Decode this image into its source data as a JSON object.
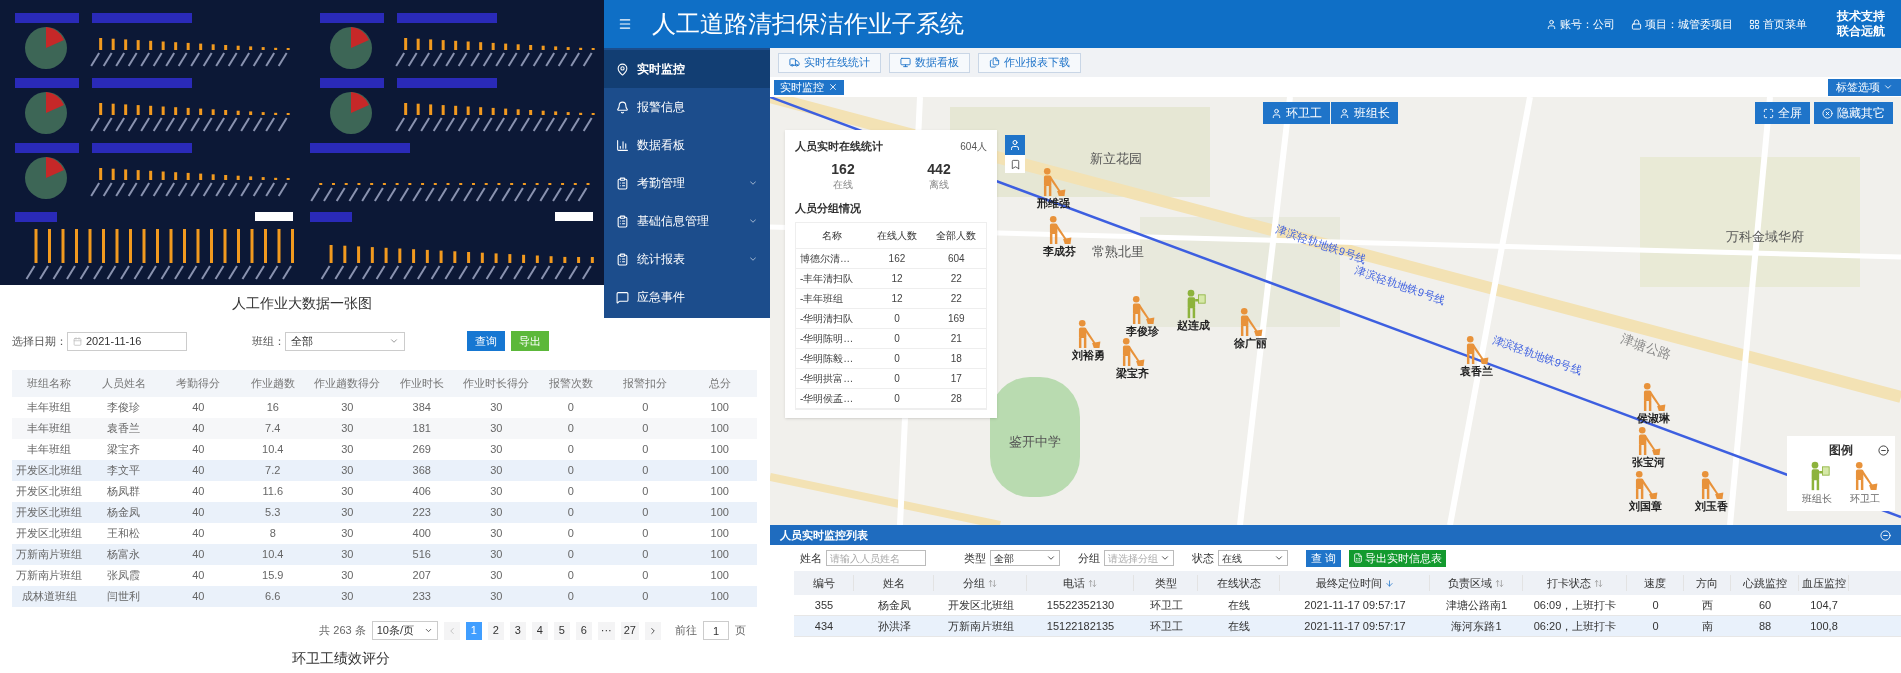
{
  "dashboard": {
    "caption": "人工作业大数据一张图"
  },
  "score_page": {
    "caption": "环卫工绩效评分",
    "filters": [
      {
        "label": "选择日期：",
        "value": "2021-11-16",
        "kind": "date"
      },
      {
        "label": "班组：",
        "value": "全部",
        "kind": "select"
      }
    ],
    "buttons": [
      {
        "label": "查询",
        "kind": "primary"
      },
      {
        "label": "导出",
        "kind": "success"
      }
    ],
    "columns": [
      "班组名称",
      "人员姓名",
      "考勤得分",
      "作业趟数",
      "作业趟数得分",
      "作业时长",
      "作业时长得分",
      "报警次数",
      "报警扣分",
      "总分"
    ],
    "rows": [
      [
        "丰年班组",
        "李俊珍",
        "40",
        "16",
        "30",
        "384",
        "30",
        "0",
        "0",
        "100"
      ],
      [
        "丰年班组",
        "袁香兰",
        "40",
        "7.4",
        "30",
        "181",
        "30",
        "0",
        "0",
        "100"
      ],
      [
        "丰年班组",
        "梁宝齐",
        "40",
        "10.4",
        "30",
        "269",
        "30",
        "0",
        "0",
        "100"
      ],
      [
        "开发区北班组",
        "李文平",
        "40",
        "7.2",
        "30",
        "368",
        "30",
        "0",
        "0",
        "100"
      ],
      [
        "开发区北班组",
        "杨凤群",
        "40",
        "11.6",
        "30",
        "406",
        "30",
        "0",
        "0",
        "100"
      ],
      [
        "开发区北班组",
        "杨金凤",
        "40",
        "5.3",
        "30",
        "223",
        "30",
        "0",
        "0",
        "100"
      ],
      [
        "开发区北班组",
        "王和松",
        "40",
        "8",
        "30",
        "400",
        "30",
        "0",
        "0",
        "100"
      ],
      [
        "万新南片班组",
        "杨富永",
        "40",
        "10.4",
        "30",
        "516",
        "30",
        "0",
        "0",
        "100"
      ],
      [
        "万新南片班组",
        "张凤霞",
        "40",
        "15.9",
        "30",
        "207",
        "30",
        "0",
        "0",
        "100"
      ],
      [
        "成林道班组",
        "闫世利",
        "40",
        "6.6",
        "30",
        "233",
        "30",
        "0",
        "0",
        "100"
      ]
    ],
    "pagination": {
      "total": "共 263 条",
      "page_size": "10条/页",
      "pages": [
        {
          "label": "1",
          "selected": true
        },
        {
          "label": "2",
          "selected": false
        },
        {
          "label": "3",
          "selected": false
        },
        {
          "label": "4",
          "selected": false
        },
        {
          "label": "5",
          "selected": false
        },
        {
          "label": "6",
          "selected": false
        },
        {
          "label": "···",
          "selected": false
        },
        {
          "label": "27",
          "selected": false
        }
      ],
      "goto_label": "前往",
      "goto_value": "1",
      "goto_suffix": "页"
    }
  },
  "app": {
    "title": "人工道路清扫保洁作业子系统",
    "header_links": [
      {
        "label": "账号：公司",
        "kind": "user"
      },
      {
        "label": "项目：城管委项目",
        "kind": "lock"
      },
      {
        "label": "首页菜单",
        "kind": "grid"
      }
    ],
    "support": [
      "技术支持",
      "联合远航"
    ],
    "sidebar": [
      {
        "label": "实时监控",
        "kind": "pin",
        "selected": true,
        "expandable": false
      },
      {
        "label": "报警信息",
        "kind": "alarm",
        "selected": false,
        "expandable": false
      },
      {
        "label": "数据看板",
        "kind": "chart",
        "selected": false,
        "expandable": false
      },
      {
        "label": "考勤管理",
        "kind": "list",
        "selected": false,
        "expandable": true
      },
      {
        "label": "基础信息管理",
        "kind": "list",
        "selected": false,
        "expandable": true
      },
      {
        "label": "统计报表",
        "kind": "list",
        "selected": false,
        "expandable": true
      },
      {
        "label": "应急事件",
        "kind": "message",
        "selected": false,
        "expandable": false
      }
    ],
    "toolbar": [
      {
        "label": "实时在线统计",
        "kind": "truck"
      },
      {
        "label": "数据看板",
        "kind": "monitor"
      },
      {
        "label": "作业报表下载",
        "kind": "files"
      }
    ],
    "open_tabs": [
      {
        "label": "实时监控",
        "selected": true
      }
    ],
    "tab_options": "标签选项",
    "map": {
      "place_labels": [
        "新立花园",
        "常熟北里",
        "万科金域华府",
        "鉴开中学"
      ],
      "road_label": "津塘公路",
      "rail_labels": [
        "津滨轻轨地铁9号线",
        "津滨轻轨地铁9号线",
        "津滨轻轨地铁9号线"
      ],
      "workers": [
        {
          "name": "邢维强",
          "kind": "cleaner"
        },
        {
          "name": "李成芬",
          "kind": "cleaner"
        },
        {
          "name": "李俊珍",
          "kind": "cleaner"
        },
        {
          "name": "赵连成",
          "kind": "leader"
        },
        {
          "name": "徐广丽",
          "kind": "cleaner"
        },
        {
          "name": "刘裕勇",
          "kind": "cleaner"
        },
        {
          "name": "梁宝齐",
          "kind": "cleaner"
        },
        {
          "name": "袁香兰",
          "kind": "cleaner"
        },
        {
          "name": "侯淑琳",
          "kind": "cleaner"
        },
        {
          "name": "张宝河",
          "kind": "cleaner"
        },
        {
          "name": "刘国章",
          "kind": "cleaner"
        },
        {
          "name": "刘玉香",
          "kind": "cleaner"
        }
      ],
      "stats": {
        "title": "人员实时在线统计",
        "total": "604人",
        "counts": [
          {
            "value": "162",
            "label": "在线"
          },
          {
            "value": "442",
            "label": "离线"
          }
        ],
        "group_title": "人员分组情况",
        "columns": [
          "名称",
          "在线人数",
          "全部人数"
        ],
        "rows": [
          [
            "博德尔清…",
            "162",
            "604"
          ],
          [
            "-丰年清扫队",
            "12",
            "22"
          ],
          [
            "-丰年班组",
            "12",
            "22"
          ],
          [
            "-华明清扫队",
            "0",
            "169"
          ],
          [
            "-华明陈明…",
            "0",
            "21"
          ],
          [
            "-华明陈毅…",
            "0",
            "18"
          ],
          [
            "-华明拱富…",
            "0",
            "17"
          ],
          [
            "-华明侯孟…",
            "0",
            "28"
          ]
        ]
      },
      "layer_buttons": [
        "环卫工",
        "班组长"
      ],
      "actions": [
        {
          "label": "全屏",
          "kind": "fullscreen"
        },
        {
          "label": "隐藏其它",
          "kind": "hide"
        }
      ],
      "legend": {
        "title": "图例",
        "items": [
          {
            "label": "班组长",
            "kind": "leader"
          },
          {
            "label": "环卫工",
            "kind": "cleaner"
          }
        ]
      }
    },
    "monitor_list": {
      "title": "人员实时监控列表",
      "filters": [
        {
          "label": "姓名",
          "kind": "text",
          "placeholder": "请输入人员姓名"
        },
        {
          "label": "类型",
          "kind": "select",
          "value": "全部"
        },
        {
          "label": "分组",
          "kind": "select",
          "placeholder": "请选择分组"
        },
        {
          "label": "状态",
          "kind": "select",
          "value": "在线"
        }
      ],
      "search_button": "查 询",
      "export_button": "导出实时信息表",
      "columns": [
        {
          "label": "编号",
          "sortable": false,
          "sorted": false
        },
        {
          "label": "姓名",
          "sortable": false,
          "sorted": false
        },
        {
          "label": "分组",
          "sortable": true,
          "sorted": false
        },
        {
          "label": "电话",
          "sortable": true,
          "sorted": false
        },
        {
          "label": "类型",
          "sortable": false,
          "sorted": false
        },
        {
          "label": "在线状态",
          "sortable": false,
          "sorted": false
        },
        {
          "label": "最终定位时间",
          "sortable": true,
          "sorted": true
        },
        {
          "label": "负责区域",
          "sortable": true,
          "sorted": false
        },
        {
          "label": "打卡状态",
          "sortable": true,
          "sorted": false
        },
        {
          "label": "速度",
          "sortable": false,
          "sorted": false
        },
        {
          "label": "方向",
          "sortable": false,
          "sorted": false
        },
        {
          "label": "心跳监控",
          "sortable": false,
          "sorted": false
        },
        {
          "label": "血压监控",
          "sortable": false,
          "sorted": false
        }
      ],
      "rows": [
        [
          "355",
          "杨金凤",
          "开发区北班组",
          "15522352130",
          "环卫工",
          "在线",
          "2021-11-17 09:57:17",
          "津塘公路南1",
          "06:09，上班打卡",
          "0",
          "西",
          "60",
          "104,7"
        ],
        [
          "434",
          "孙洪泽",
          "万新南片班组",
          "15122182135",
          "环卫工",
          "在线",
          "2021-11-17 09:57:17",
          "海河东路1",
          "06:20，上班打卡",
          "0",
          "南",
          "88",
          "100,8"
        ]
      ]
    }
  }
}
